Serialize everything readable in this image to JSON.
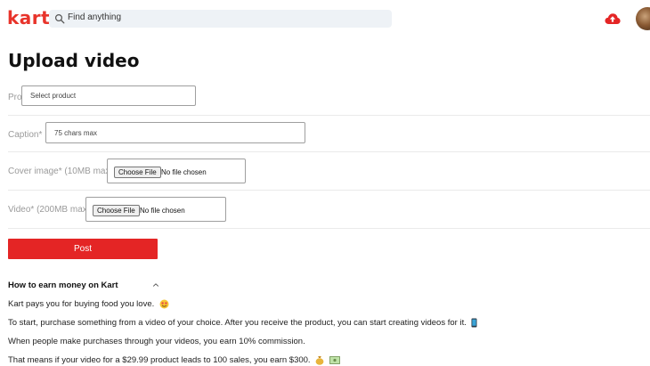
{
  "header": {
    "logo": "kart",
    "search_placeholder": "Find anything",
    "upload_icon": "cloud-upload-icon",
    "avatar": "user-avatar"
  },
  "page": {
    "title": "Upload video"
  },
  "form": {
    "product": {
      "label": "Product*",
      "value": "Select product"
    },
    "caption": {
      "label": "Caption*",
      "placeholder": "75 chars max"
    },
    "cover": {
      "label": "Cover image* (10MB max)",
      "button": "Choose File",
      "status": "No file chosen"
    },
    "video": {
      "label": "Video* (200MB max)",
      "button": "Choose File",
      "status": "No file chosen"
    },
    "post_label": "Post"
  },
  "earn": {
    "heading": "How to earn money on Kart",
    "lines": [
      "Kart pays you for buying food you love.",
      "To start, purchase something from a video of your choice. After you receive the product, you can start creating videos for it.",
      "When people make purchases through your videos, you earn 10% commission.",
      "That means if your video for a $29.99 product leads to 100 sales, you earn $300."
    ]
  },
  "colors": {
    "brand": "#e8342b",
    "post_button": "#e42525",
    "search_bg": "#eef2f6"
  }
}
